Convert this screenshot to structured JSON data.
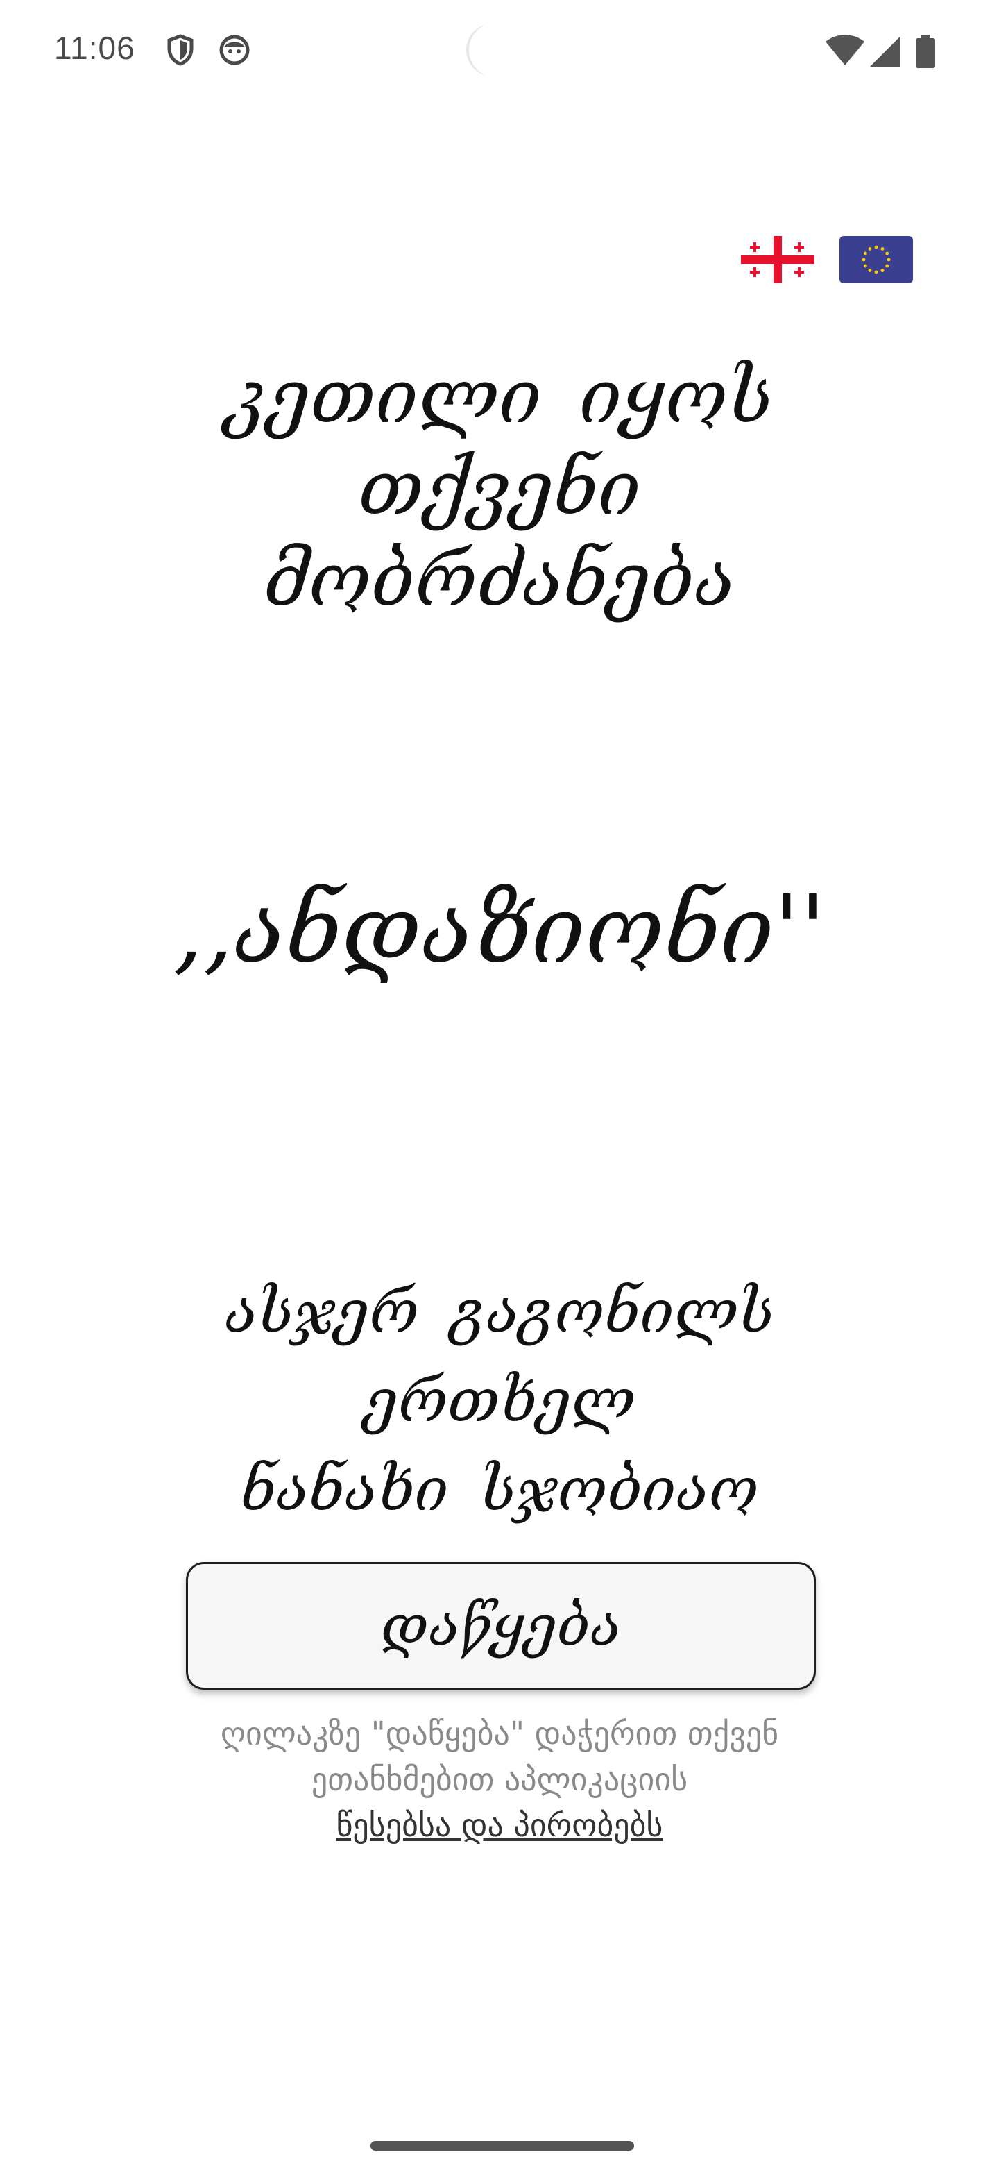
{
  "status_bar": {
    "time": "11:06",
    "left_icons": [
      "shield-icon",
      "smiley-face-icon"
    ],
    "right_icons": [
      "wifi-icon",
      "cellular-signal-icon",
      "battery-icon"
    ]
  },
  "flags": {
    "georgia_label": "Georgia",
    "eu_label": "EU",
    "georgia_colors": {
      "field": "#ffffff",
      "cross": "#e8112d"
    },
    "eu_colors": {
      "field": "#3b3f8f",
      "stars": "#ffcc00"
    }
  },
  "welcome": {
    "line1": "კეთილი იყოს თქვენი",
    "line2": "მობრძანება"
  },
  "app_name": ",,ანდაზიონი''",
  "tagline": {
    "line1": "ასჯერ გაგონილს ერთხელ",
    "line2": "ნანახი სჯობიაო"
  },
  "start_button": {
    "label": "დაწყება"
  },
  "terms": {
    "line1": "ღილაკზე \"დაწყება\" დაჭერით თქვენ",
    "line2": "ეთანხმებით აპლიკაციის",
    "link": "წესებსა და პირობებს"
  }
}
